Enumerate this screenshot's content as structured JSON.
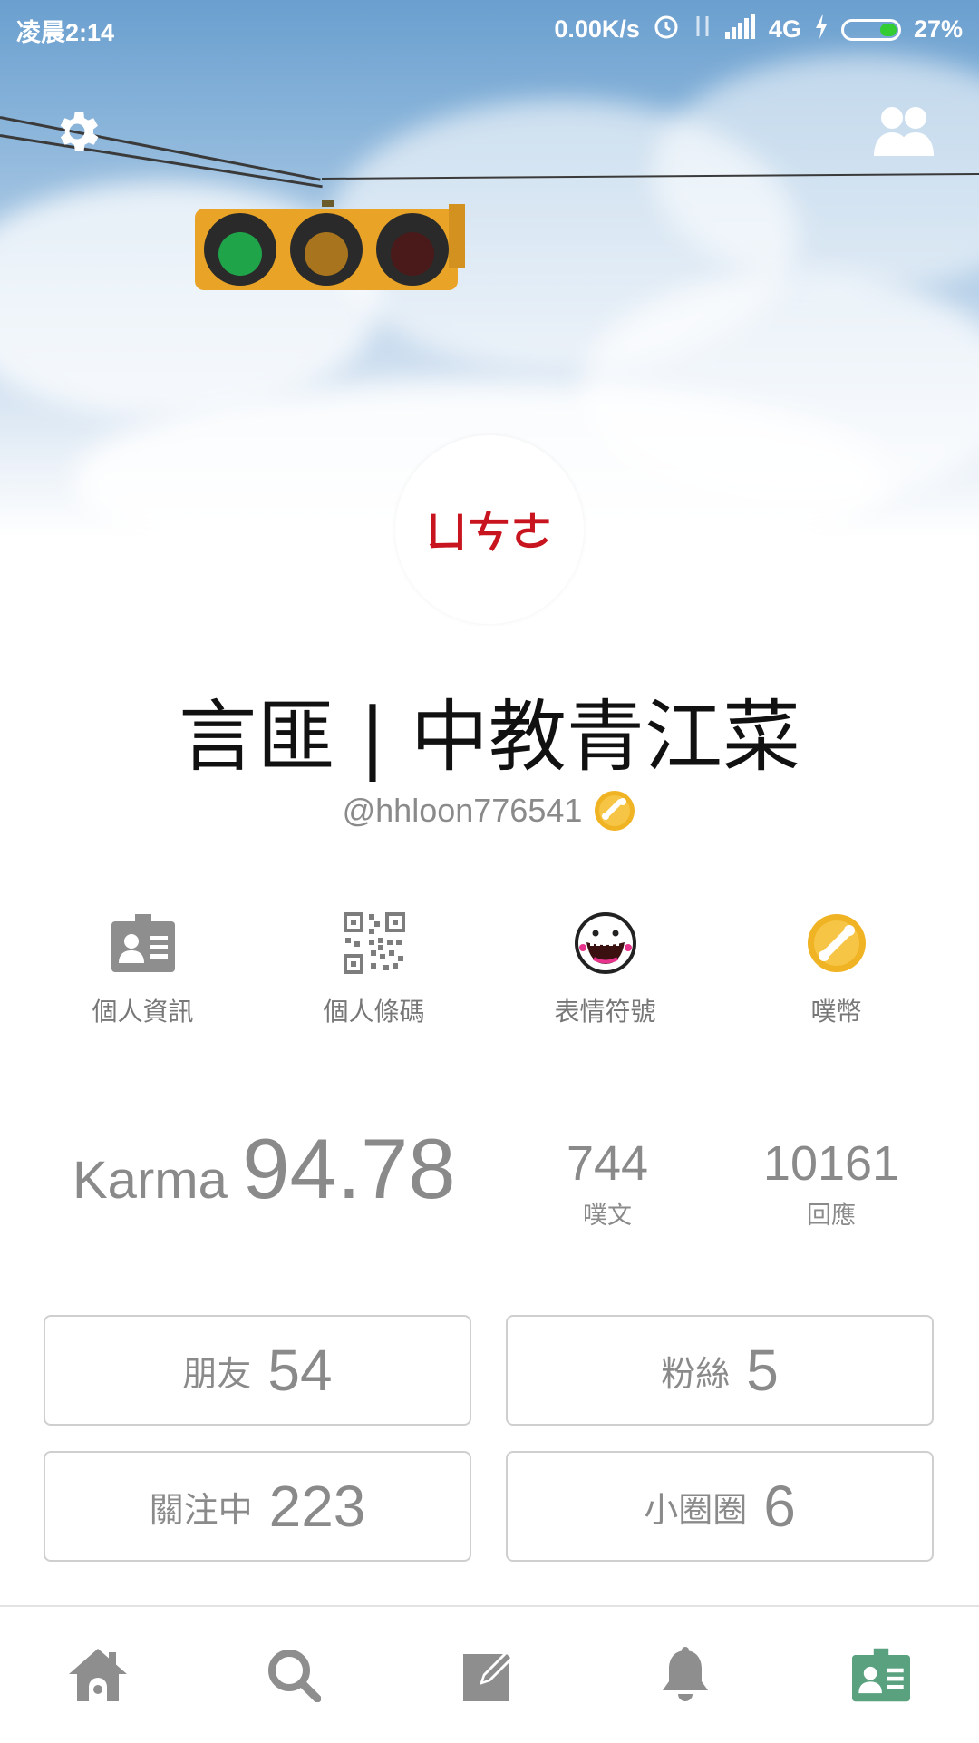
{
  "status_bar": {
    "time": "凌晨2:14",
    "net_speed": "0.00K/s",
    "network": "4G",
    "battery": "27%"
  },
  "profile": {
    "avatar_text": "ㄩㄘㄜ",
    "display_name": "言匪 | 中教青江菜",
    "handle": "@hhloon776541"
  },
  "shortcuts": [
    {
      "label": "個人資訊",
      "icon": "profile-card-icon"
    },
    {
      "label": "個人條碼",
      "icon": "qr-code-icon"
    },
    {
      "label": "表情符號",
      "icon": "emoticon-icon"
    },
    {
      "label": "噗幣",
      "icon": "plurk-coin-icon"
    }
  ],
  "stats": {
    "karma_label": "Karma",
    "karma_value": "94.78",
    "posts_value": "744",
    "posts_label": "噗文",
    "replies_value": "10161",
    "replies_label": "回應"
  },
  "relations": {
    "friends_label": "朋友",
    "friends_value": "54",
    "fans_label": "粉絲",
    "fans_value": "5",
    "following_label": "關注中",
    "following_value": "223",
    "cliques_label": "小圈圈",
    "cliques_value": "6"
  },
  "tabbar": [
    "home-icon",
    "search-icon",
    "compose-icon",
    "notification-bell-icon",
    "profile-card-icon"
  ],
  "colors": {
    "accent": "#5aa17f",
    "icon_gray": "#8e8e8e",
    "avatar_red": "#c8141e",
    "coin_gold": "#f0b323"
  }
}
